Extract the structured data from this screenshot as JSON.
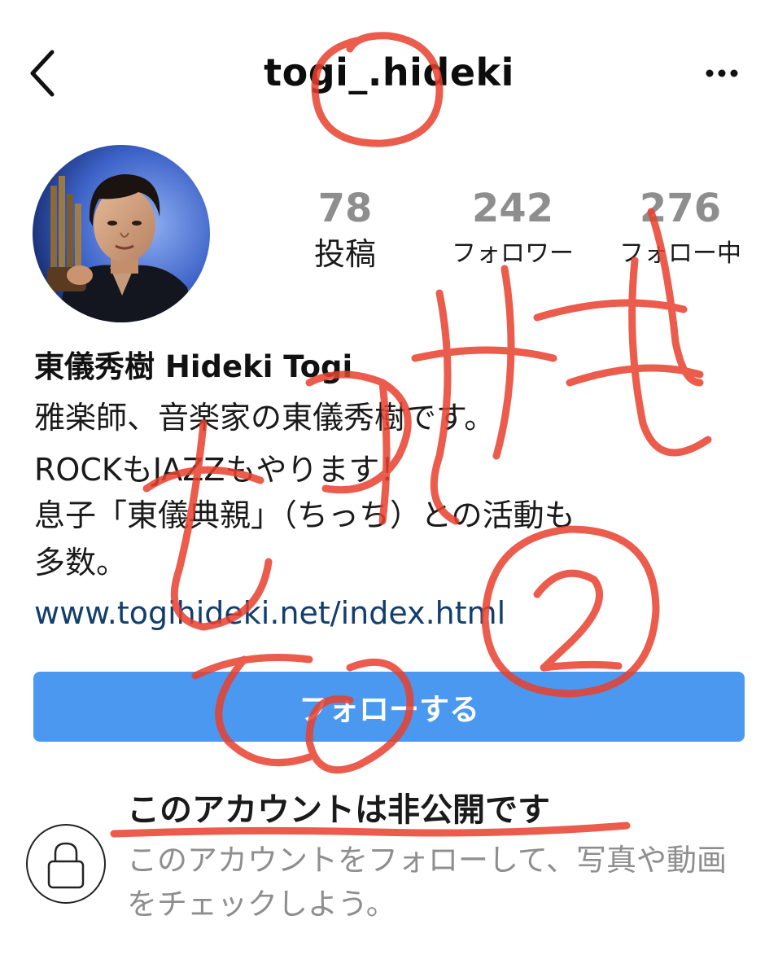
{
  "header": {
    "username": "togi_.hideki"
  },
  "stats": {
    "posts": {
      "count": "78",
      "label": "投稿"
    },
    "followers": {
      "count": "242",
      "label": "フォロワー"
    },
    "following": {
      "count": "276",
      "label": "フォロー中"
    }
  },
  "bio": {
    "name": "東儀秀樹 Hideki Togi",
    "lines": [
      "雅楽師、音楽家の東儀秀樹です。",
      "ROCKもJAZZもやります！",
      "息子「東儀典親」（ちっち）との活動も",
      "多数。"
    ],
    "link": "www.togihideki.net/index.html"
  },
  "follow_button": {
    "label": "フォローする"
  },
  "private_notice": {
    "title": "このアカウントは非公開です",
    "description": "このアカウントをフォローして、写真や動画をチェックしよう。"
  },
  "annotations": {
    "ink_color": "#e8402e",
    "marks": [
      "circle-around-underscore",
      "underline-private-title",
      "circled-number-2",
      "handwritten-vertical-text"
    ]
  },
  "colors": {
    "follow_button": "#4a98f0",
    "link": "#123e6e",
    "stat_number": "#8e8e8e",
    "secondary_text": "#8e8e8e"
  },
  "icons": {
    "back": "chevron-left-icon",
    "more": "ellipsis-icon",
    "lock": "lock-icon"
  }
}
